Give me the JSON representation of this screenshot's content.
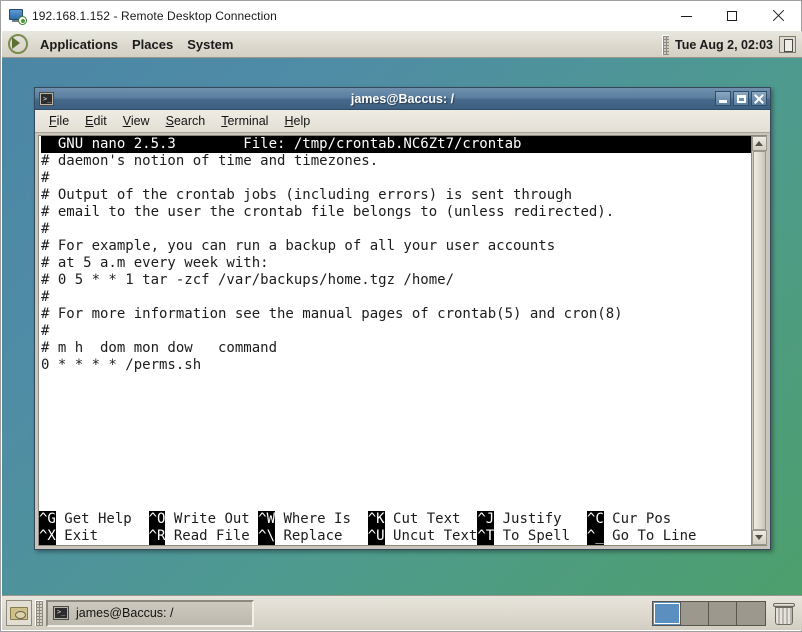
{
  "rdc_window": {
    "title": "192.168.1.152 - Remote Desktop Connection",
    "icon": "remote-desktop-icon",
    "buttons": {
      "minimize": "—",
      "maximize": "□",
      "close": "✕"
    }
  },
  "gnome_panel": {
    "logo": "gnome-foot-icon",
    "menus": [
      {
        "label": "Applications"
      },
      {
        "label": "Places"
      },
      {
        "label": "System"
      }
    ],
    "clock": "Tue Aug  2, 02:03",
    "tray_icon": "device-icon"
  },
  "terminal_window": {
    "title": "james@Baccus: /",
    "icon": "terminal-icon",
    "buttons": {
      "minimize": "_",
      "maximize": "□",
      "close": "✕"
    },
    "menubar": [
      {
        "label": "File",
        "mnemonic": "F"
      },
      {
        "label": "Edit",
        "mnemonic": "E"
      },
      {
        "label": "View",
        "mnemonic": "V"
      },
      {
        "label": "Search",
        "mnemonic": "S"
      },
      {
        "label": "Terminal",
        "mnemonic": "T"
      },
      {
        "label": "Help",
        "mnemonic": "H"
      }
    ]
  },
  "nano": {
    "header_left": "  GNU nano 2.5.3",
    "header_middle": "        File: /tmp/crontab.NC6Zt7/crontab",
    "version": "2.5.3",
    "filename": "/tmp/crontab.NC6Zt7/crontab",
    "buffer_text": "# daemon's notion of time and timezones.\n#\n# Output of the crontab jobs (including errors) is sent through\n# email to the user the crontab file belongs to (unless redirected).\n#\n# For example, you can run a backup of all your user accounts\n# at 5 a.m every week with:\n# 0 5 * * 1 tar -zcf /var/backups/home.tgz /home/\n#\n# For more information see the manual pages of crontab(5) and cron(8)\n#\n# m h  dom mon dow   command\n0 * * * * /perms.sh",
    "shortcuts_row1": [
      {
        "key": "^G",
        "label": " Get Help  "
      },
      {
        "key": "^O",
        "label": " Write Out "
      },
      {
        "key": "^W",
        "label": " Where Is  "
      },
      {
        "key": "^K",
        "label": " Cut Text  "
      },
      {
        "key": "^J",
        "label": " Justify   "
      },
      {
        "key": "^C",
        "label": " Cur Pos"
      }
    ],
    "shortcuts_row2": [
      {
        "key": "^X",
        "label": " Exit      "
      },
      {
        "key": "^R",
        "label": " Read File "
      },
      {
        "key": "^\\",
        "label": " Replace   "
      },
      {
        "key": "^U",
        "label": " Uncut Text"
      },
      {
        "key": "^T",
        "label": " To Spell  "
      },
      {
        "key": "^_",
        "label": " Go To Line"
      }
    ],
    "scrollbar": {
      "up_arrow": "scroll-up-icon",
      "down_arrow": "scroll-down-icon"
    }
  },
  "taskbar": {
    "show_desktop_icon": "show-desktop-icon",
    "tasks": [
      {
        "label": "james@Baccus: /",
        "icon": "terminal-icon",
        "active": true
      }
    ],
    "workspaces": [
      {
        "active": true
      },
      {
        "active": false
      },
      {
        "active": false
      },
      {
        "active": false
      }
    ],
    "trash_icon": "trash-icon"
  },
  "colors": {
    "desktop_start": "#4b87a5",
    "desktop_end": "#4d9f6c",
    "titlebar": "#46688a",
    "panel": "#dedad0",
    "nano_bar_bg": "#000000",
    "nano_bar_fg": "#ffffff",
    "terminal_bg": "#ffffff",
    "terminal_fg": "#1c1c1c",
    "workspace_active": "#5b8fc0"
  }
}
